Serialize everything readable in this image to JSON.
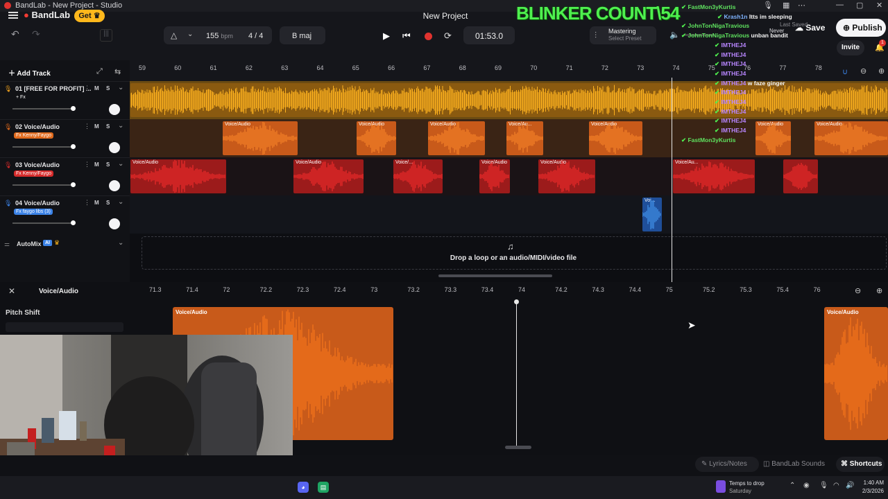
{
  "window": {
    "title": "BandLab - New Project - Studio"
  },
  "overlay": {
    "counter": "BLINKER COUNT\\54",
    "chat": [
      {
        "user": "FastMon3yKurtis",
        "msg": "",
        "color": "#5fe25f"
      },
      {
        "user": "Krash1n",
        "msg": "Itts im sleeping",
        "color": "#7fb3ff"
      },
      {
        "user": "JohnTonNigaTravious",
        "msg": "",
        "color": "#5fe25f"
      },
      {
        "user": "JohnTonNigaTravious",
        "msg": "unban bandit",
        "color": "#5fe25f"
      },
      {
        "user": "IMTHEJ4",
        "msg": "",
        "color": "#b886ff"
      },
      {
        "user": "IMTHEJ4",
        "msg": "",
        "color": "#b886ff"
      },
      {
        "user": "IMTHEJ4",
        "msg": "",
        "color": "#b886ff"
      },
      {
        "user": "IMTHEJ4",
        "msg": "",
        "color": "#b886ff"
      },
      {
        "user": "IMTHEJ4",
        "msg": "w faze ginger",
        "color": "#b886ff"
      },
      {
        "user": "IMTHEJ4",
        "msg": "",
        "color": "#b886ff"
      },
      {
        "user": "IMTHEJ4",
        "msg": "",
        "color": "#b886ff"
      },
      {
        "user": "IMTHEJ4",
        "msg": "",
        "color": "#b886ff"
      },
      {
        "user": "IMTHEJ4",
        "msg": "",
        "color": "#b886ff"
      },
      {
        "user": "IMTHEJ4",
        "msg": "",
        "color": "#b886ff"
      },
      {
        "user": "FastMon3yKurtis",
        "msg": "",
        "color": "#5fe25f"
      }
    ],
    "last_saved": "Last Saved",
    "never": "Never"
  },
  "header": {
    "brand": "BandLab",
    "get_label": "Get",
    "project_title": "New Project",
    "bpm": "155",
    "bpm_unit": "bpm",
    "time_sig": "4 / 4",
    "key": "B maj",
    "time": "01:53.0",
    "mastering_label": "Mastering",
    "mastering_sub": "Select Preset",
    "save_label": "Save",
    "publish_label": "Publish",
    "invite_label": "Invite",
    "notif_count": "1"
  },
  "toolbar": {
    "add_track": "Add Track"
  },
  "ruler": [
    "59",
    "60",
    "61",
    "62",
    "63",
    "64",
    "65",
    "66",
    "67",
    "68",
    "69",
    "70",
    "71",
    "72",
    "73",
    "74",
    "75",
    "76",
    "77",
    "78"
  ],
  "tracks": [
    {
      "name": "01  [FREE FOR PROFIT] ...",
      "fx": "+ Fx",
      "color": "#f0a21e"
    },
    {
      "name": "02  Voice/Audio",
      "fx": "Fx Kenny/Faygo",
      "color": "#e06a1d"
    },
    {
      "name": "03  Voice/Audio",
      "fx": "Fx Kenny/Faygo",
      "color": "#d62b2b"
    },
    {
      "name": "04  Voice/Audio",
      "fx": "Fx faygo libs (3)",
      "color": "#3b82e6"
    }
  ],
  "clips": {
    "track2": [
      "Voice/Audio",
      "Voice/Audio",
      "Voice/Audio",
      "Voice/Au...",
      "Voice/Audio",
      "Voice/Audio",
      "Voice/Audio"
    ],
    "track3": [
      "Voice/Audio",
      "Voice/Audio",
      "Voice/...",
      "Voice/Audio",
      "Voice/Audio",
      "Voice/Au..."
    ],
    "track4": [
      "Voi..."
    ]
  },
  "automix": {
    "label": "AutoMix",
    "badge": "AI"
  },
  "dropzone": {
    "text": "Drop a loop or an audio/MIDI/video file"
  },
  "editor": {
    "title": "Voice/Audio",
    "pitch_shift": "Pitch Shift",
    "ruler": [
      "71.3",
      "71.4",
      "72",
      "72.2",
      "72.3",
      "72.4",
      "73",
      "73.2",
      "73.3",
      "73.4",
      "74",
      "74.2",
      "74.3",
      "74.4",
      "75",
      "75.2",
      "75.3",
      "75.4",
      "76"
    ],
    "clip_labels": [
      "Voice/Audio",
      "Voice/Audio"
    ]
  },
  "footer": {
    "lyrics": "Lyrics/Notes",
    "sounds": "BandLab Sounds",
    "shortcuts": "Shortcuts"
  },
  "taskbar": {
    "weather_title": "Temps to drop",
    "weather_sub": "Saturday",
    "time": "1:40 AM",
    "date": "2/3/2026"
  }
}
